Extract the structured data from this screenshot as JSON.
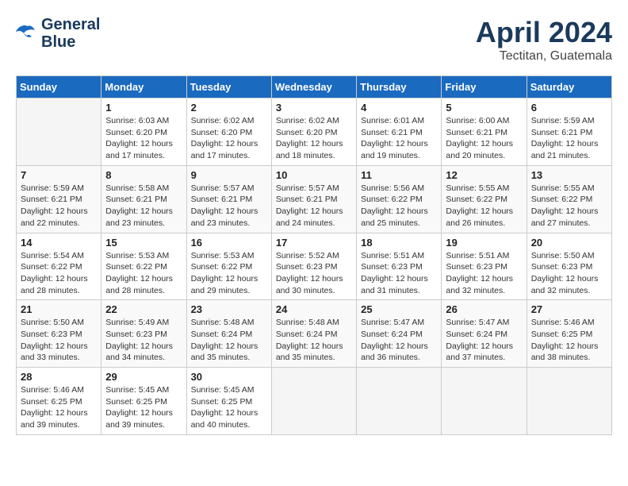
{
  "header": {
    "logo_line1": "General",
    "logo_line2": "Blue",
    "month_year": "April 2024",
    "location": "Tectitan, Guatemala"
  },
  "weekdays": [
    "Sunday",
    "Monday",
    "Tuesday",
    "Wednesday",
    "Thursday",
    "Friday",
    "Saturday"
  ],
  "weeks": [
    [
      {
        "day": "",
        "info": ""
      },
      {
        "day": "1",
        "info": "Sunrise: 6:03 AM\nSunset: 6:20 PM\nDaylight: 12 hours\nand 17 minutes."
      },
      {
        "day": "2",
        "info": "Sunrise: 6:02 AM\nSunset: 6:20 PM\nDaylight: 12 hours\nand 17 minutes."
      },
      {
        "day": "3",
        "info": "Sunrise: 6:02 AM\nSunset: 6:20 PM\nDaylight: 12 hours\nand 18 minutes."
      },
      {
        "day": "4",
        "info": "Sunrise: 6:01 AM\nSunset: 6:21 PM\nDaylight: 12 hours\nand 19 minutes."
      },
      {
        "day": "5",
        "info": "Sunrise: 6:00 AM\nSunset: 6:21 PM\nDaylight: 12 hours\nand 20 minutes."
      },
      {
        "day": "6",
        "info": "Sunrise: 5:59 AM\nSunset: 6:21 PM\nDaylight: 12 hours\nand 21 minutes."
      }
    ],
    [
      {
        "day": "7",
        "info": "Sunrise: 5:59 AM\nSunset: 6:21 PM\nDaylight: 12 hours\nand 22 minutes."
      },
      {
        "day": "8",
        "info": "Sunrise: 5:58 AM\nSunset: 6:21 PM\nDaylight: 12 hours\nand 23 minutes."
      },
      {
        "day": "9",
        "info": "Sunrise: 5:57 AM\nSunset: 6:21 PM\nDaylight: 12 hours\nand 23 minutes."
      },
      {
        "day": "10",
        "info": "Sunrise: 5:57 AM\nSunset: 6:21 PM\nDaylight: 12 hours\nand 24 minutes."
      },
      {
        "day": "11",
        "info": "Sunrise: 5:56 AM\nSunset: 6:22 PM\nDaylight: 12 hours\nand 25 minutes."
      },
      {
        "day": "12",
        "info": "Sunrise: 5:55 AM\nSunset: 6:22 PM\nDaylight: 12 hours\nand 26 minutes."
      },
      {
        "day": "13",
        "info": "Sunrise: 5:55 AM\nSunset: 6:22 PM\nDaylight: 12 hours\nand 27 minutes."
      }
    ],
    [
      {
        "day": "14",
        "info": "Sunrise: 5:54 AM\nSunset: 6:22 PM\nDaylight: 12 hours\nand 28 minutes."
      },
      {
        "day": "15",
        "info": "Sunrise: 5:53 AM\nSunset: 6:22 PM\nDaylight: 12 hours\nand 28 minutes."
      },
      {
        "day": "16",
        "info": "Sunrise: 5:53 AM\nSunset: 6:22 PM\nDaylight: 12 hours\nand 29 minutes."
      },
      {
        "day": "17",
        "info": "Sunrise: 5:52 AM\nSunset: 6:23 PM\nDaylight: 12 hours\nand 30 minutes."
      },
      {
        "day": "18",
        "info": "Sunrise: 5:51 AM\nSunset: 6:23 PM\nDaylight: 12 hours\nand 31 minutes."
      },
      {
        "day": "19",
        "info": "Sunrise: 5:51 AM\nSunset: 6:23 PM\nDaylight: 12 hours\nand 32 minutes."
      },
      {
        "day": "20",
        "info": "Sunrise: 5:50 AM\nSunset: 6:23 PM\nDaylight: 12 hours\nand 32 minutes."
      }
    ],
    [
      {
        "day": "21",
        "info": "Sunrise: 5:50 AM\nSunset: 6:23 PM\nDaylight: 12 hours\nand 33 minutes."
      },
      {
        "day": "22",
        "info": "Sunrise: 5:49 AM\nSunset: 6:23 PM\nDaylight: 12 hours\nand 34 minutes."
      },
      {
        "day": "23",
        "info": "Sunrise: 5:48 AM\nSunset: 6:24 PM\nDaylight: 12 hours\nand 35 minutes."
      },
      {
        "day": "24",
        "info": "Sunrise: 5:48 AM\nSunset: 6:24 PM\nDaylight: 12 hours\nand 35 minutes."
      },
      {
        "day": "25",
        "info": "Sunrise: 5:47 AM\nSunset: 6:24 PM\nDaylight: 12 hours\nand 36 minutes."
      },
      {
        "day": "26",
        "info": "Sunrise: 5:47 AM\nSunset: 6:24 PM\nDaylight: 12 hours\nand 37 minutes."
      },
      {
        "day": "27",
        "info": "Sunrise: 5:46 AM\nSunset: 6:25 PM\nDaylight: 12 hours\nand 38 minutes."
      }
    ],
    [
      {
        "day": "28",
        "info": "Sunrise: 5:46 AM\nSunset: 6:25 PM\nDaylight: 12 hours\nand 39 minutes."
      },
      {
        "day": "29",
        "info": "Sunrise: 5:45 AM\nSunset: 6:25 PM\nDaylight: 12 hours\nand 39 minutes."
      },
      {
        "day": "30",
        "info": "Sunrise: 5:45 AM\nSunset: 6:25 PM\nDaylight: 12 hours\nand 40 minutes."
      },
      {
        "day": "",
        "info": ""
      },
      {
        "day": "",
        "info": ""
      },
      {
        "day": "",
        "info": ""
      },
      {
        "day": "",
        "info": ""
      }
    ]
  ]
}
